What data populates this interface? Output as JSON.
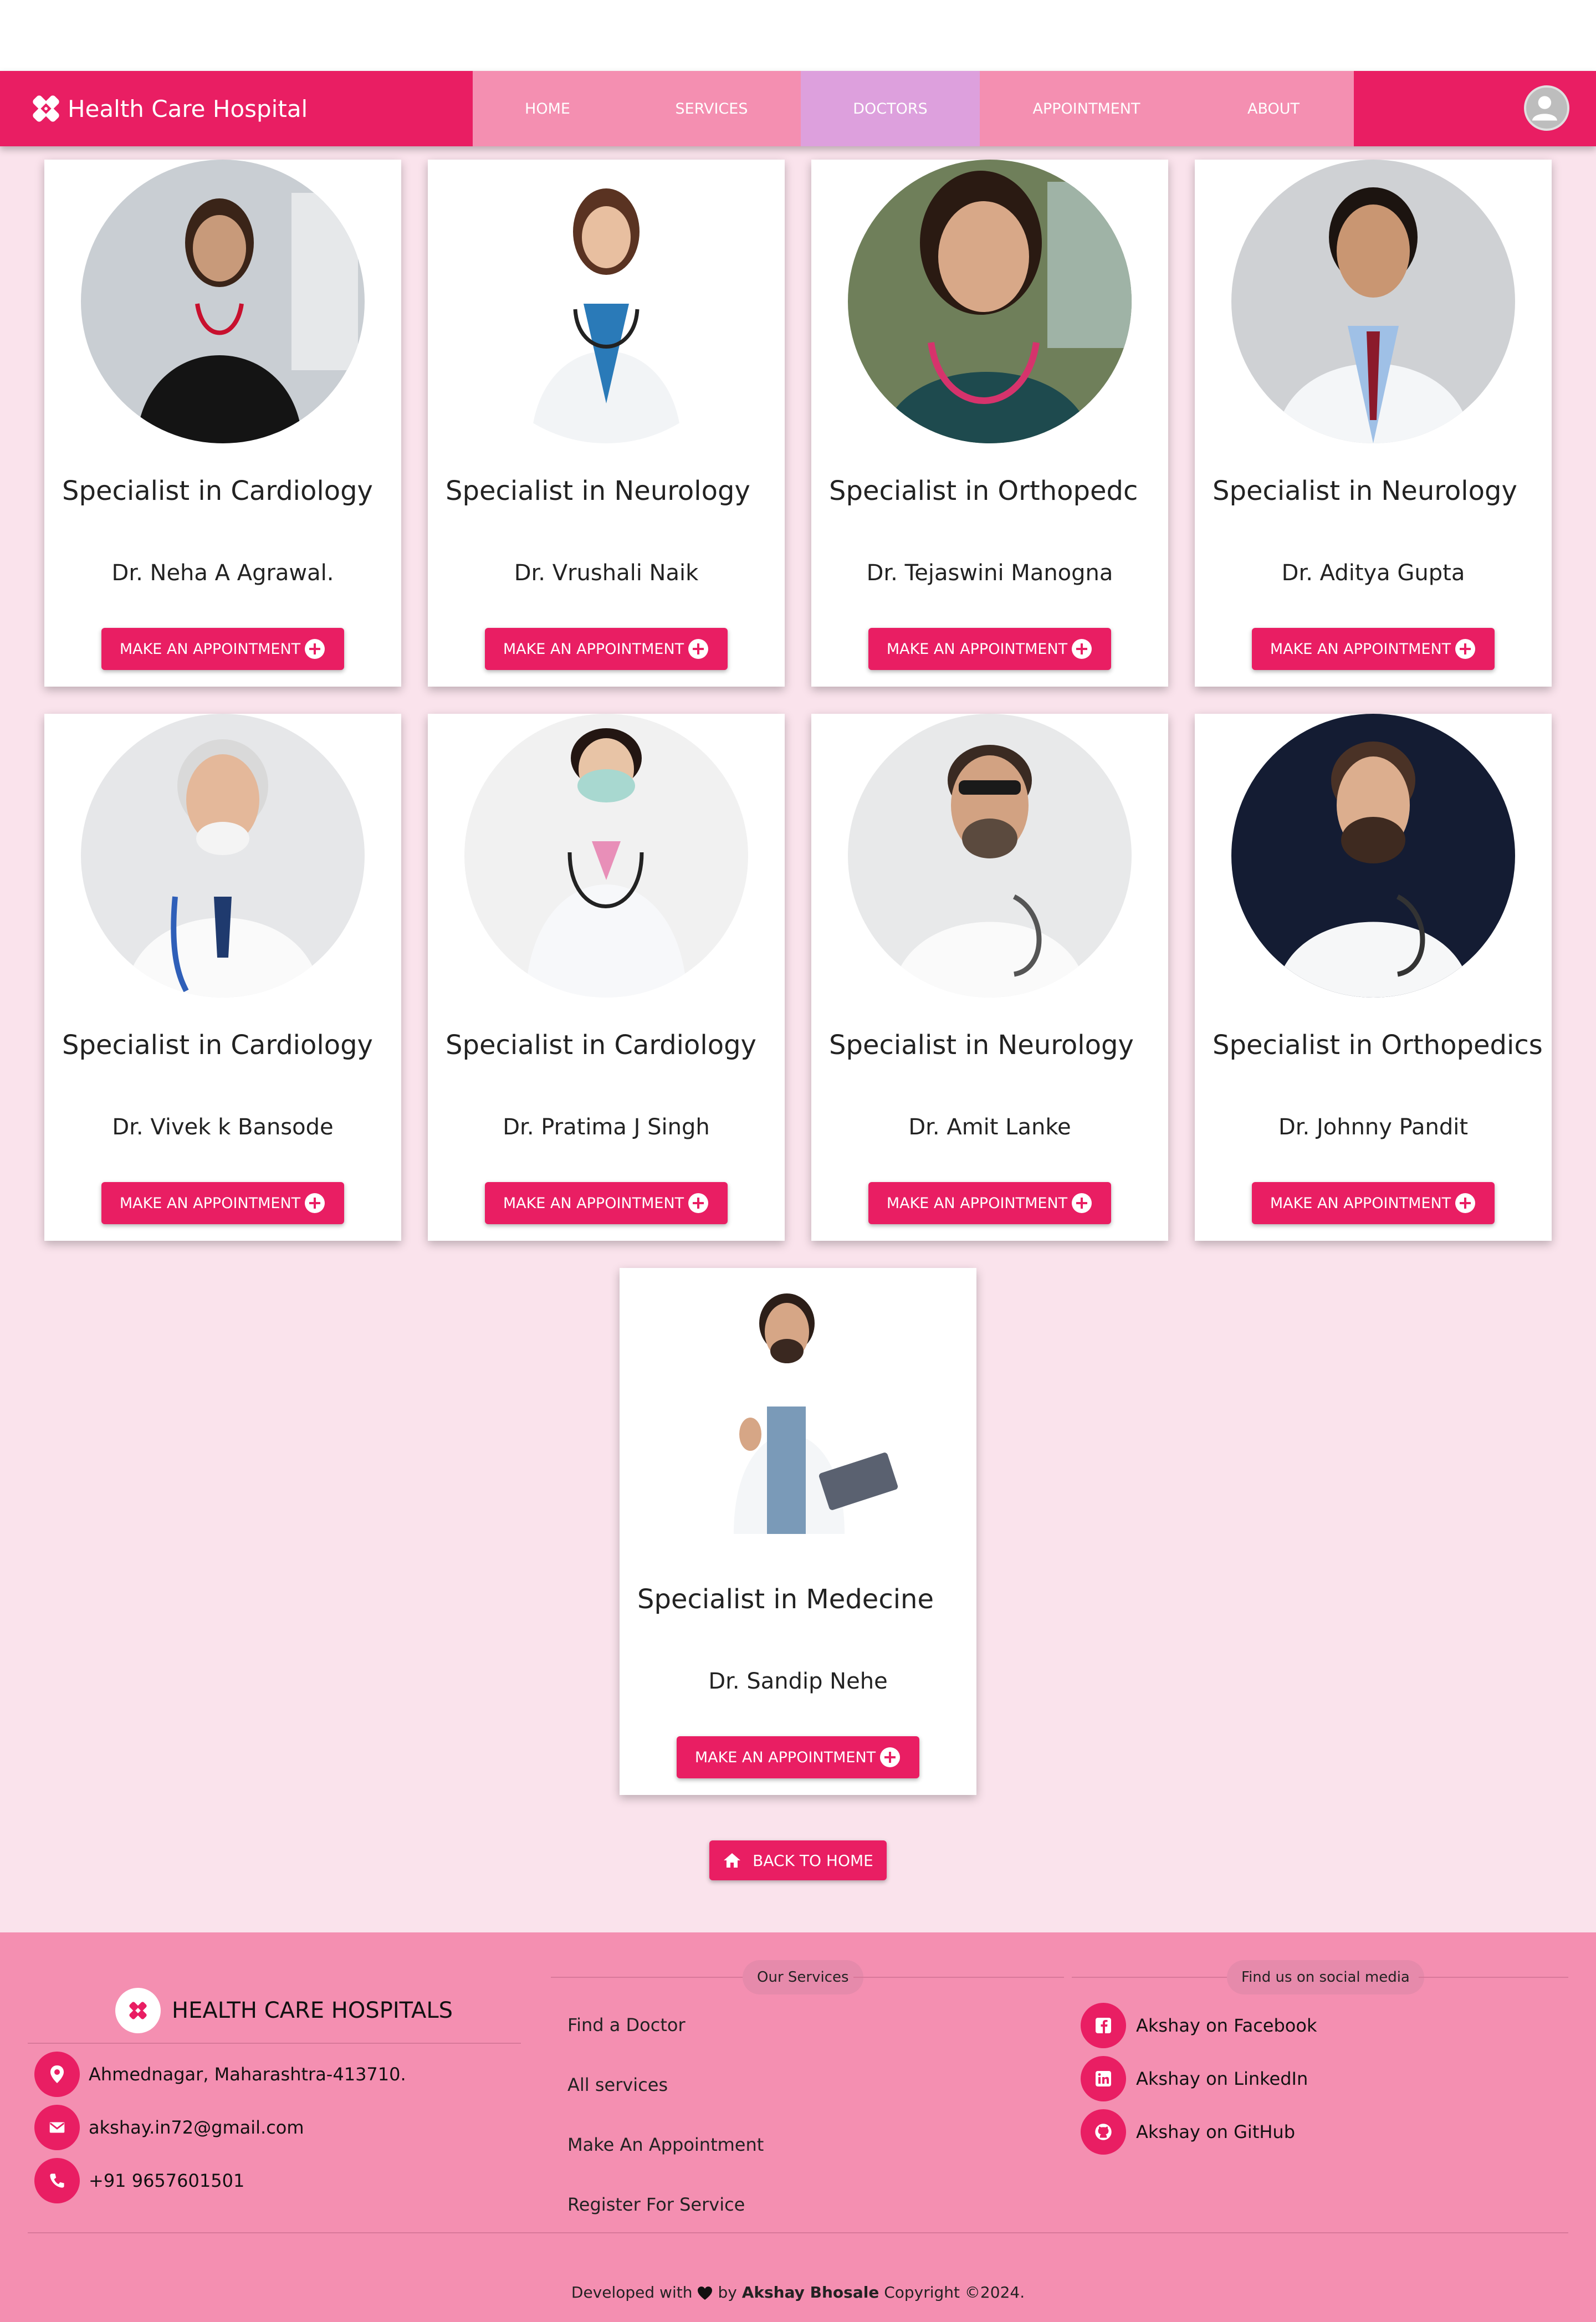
{
  "brand": {
    "name": "Health Care Hospital"
  },
  "nav": {
    "items": [
      {
        "label": "HOME"
      },
      {
        "label": "SERVICES"
      },
      {
        "label": "DOCTORS"
      },
      {
        "label": "APPOINTMENT"
      },
      {
        "label": "ABOUT"
      }
    ],
    "active": "DOCTORS"
  },
  "doctors": [
    {
      "specialty": "Specialist in Cardiology",
      "name": "Dr. Neha A Agrawal.",
      "button": "MAKE AN APPOINTMENT"
    },
    {
      "specialty": "Specialist in Neurology",
      "name": "Dr. Vrushali Naik",
      "button": "MAKE AN APPOINTMENT"
    },
    {
      "specialty": "Specialist in Orthopedc",
      "name": "Dr. Tejaswini Manogna",
      "button": "MAKE AN APPOINTMENT"
    },
    {
      "specialty": "Specialist in Neurology",
      "name": "Dr. Aditya Gupta",
      "button": "MAKE AN APPOINTMENT"
    },
    {
      "specialty": "Specialist in Cardiology",
      "name": "Dr. Vivek k Bansode",
      "button": "MAKE AN APPOINTMENT"
    },
    {
      "specialty": "Specialist in Cardiology",
      "name": "Dr. Pratima J Singh",
      "button": "MAKE AN APPOINTMENT"
    },
    {
      "specialty": "Specialist in Neurology",
      "name": "Dr. Amit Lanke",
      "button": "MAKE AN APPOINTMENT"
    },
    {
      "specialty": "Specialist in Orthopedics",
      "name": "Dr. Johnny Pandit",
      "button": "MAKE AN APPOINTMENT"
    },
    {
      "specialty": "Specialist in Medecine",
      "name": "Dr. Sandip Nehe",
      "button": "MAKE AN APPOINTMENT"
    }
  ],
  "back_button": "BACK TO HOME",
  "footer": {
    "brand": "HEALTH CARE HOSPITALS",
    "address": "Ahmednagar, Maharashtra-413710.",
    "email": "akshay.in72@gmail.com",
    "phone": "+91 9657601501",
    "services_title": "Our Services",
    "services": [
      "Find a Doctor",
      "All services",
      "Make An Appointment",
      "Register For Service"
    ],
    "social_title": "Find us on social media",
    "social": [
      "Akshay on Facebook",
      "Akshay on LinkedIn",
      "Akshay on GitHub"
    ],
    "copyright": {
      "prefix": "Developed with",
      "by": "by",
      "author": "Akshay Bhosale",
      "suffix": "Copyright ©2024."
    }
  },
  "colors": {
    "primary": "#e91e63",
    "nav_menu": "#f48fb1",
    "nav_active": "#dda0dd",
    "page_bg": "#fae3ec",
    "footer_bg": "#f48fb1"
  }
}
